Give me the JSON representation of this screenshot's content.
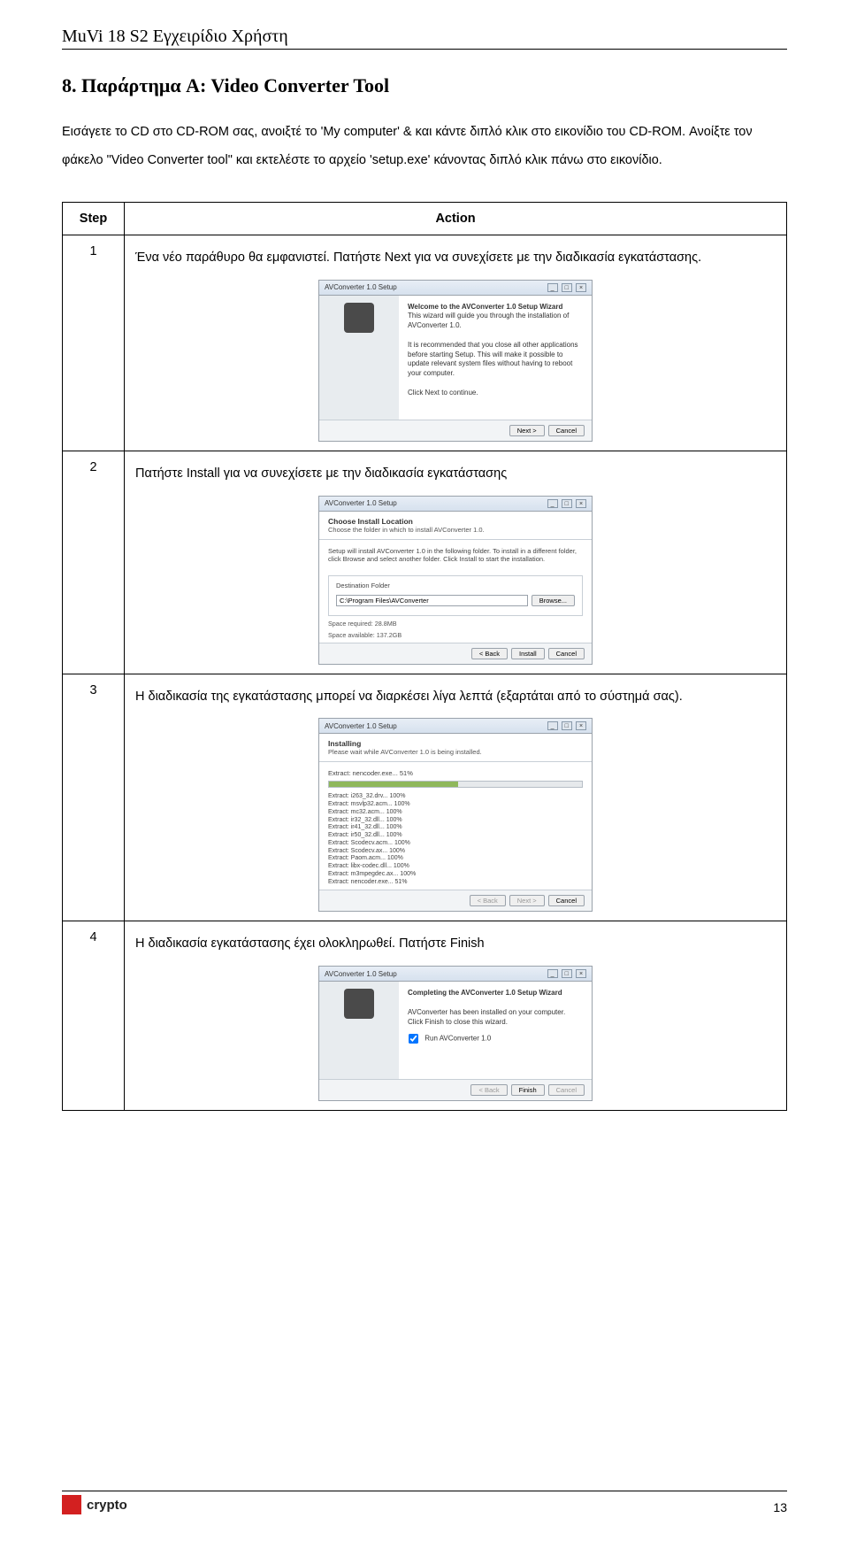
{
  "doc": {
    "header": "MuVi 18 S2 Εγχειρίδιο Χρήστη",
    "section_title": "8.    Παράρτημα A: Video Converter Tool",
    "intro": "Εισάγετε το CD στο CD-ROM σας, ανοιξτέ το 'My computer' & και κάντε διπλό κλικ στο εικονίδιο του CD-ROM. Ανοίξτε τον φάκελο \"Video Converter tool\" και εκτελέστε το αρχείο 'setup.exe' κάνοντας διπλό κλικ πάνω στο εικονίδιο.",
    "logo_text": "crypto",
    "page_number": "13"
  },
  "table": {
    "head_step": "Step",
    "head_action": "Action",
    "rows": [
      {
        "num": "1",
        "text": "Ένα νέο παράθυρο θα εμφανιστεί. Πατήστε Next για να συνεχίσετε με την διαδικασία εγκατάστασης."
      },
      {
        "num": "2",
        "text": "Πατήστε Install για να συνεχίσετε με την διαδικασία εγκατάστασης"
      },
      {
        "num": "3",
        "text": "Η διαδικασία της εγκατάστασης μπορεί να διαρκέσει λίγα λεπτά (εξαρτάται από το σύστημά σας)."
      },
      {
        "num": "4",
        "text": "Η διαδικασία εγκατάστασης έχει ολοκληρωθεί. Πατήστε Finish"
      }
    ]
  },
  "installer": {
    "title": "AVConverter 1.0 Setup",
    "step1": {
      "heading": "Welcome to the AVConverter 1.0 Setup Wizard",
      "p1": "This wizard will guide you through the installation of AVConverter 1.0.",
      "p2": "It is recommended that you close all other applications before starting Setup. This will make it possible to update relevant system files without having to reboot your computer.",
      "p3": "Click Next to continue.",
      "btn_next": "Next >",
      "btn_cancel": "Cancel"
    },
    "step2": {
      "h1": "Choose Install Location",
      "h2": "Choose the folder in which to install AVConverter 1.0.",
      "p1": "Setup will install AVConverter 1.0 in the following folder. To install in a different folder, click Browse and select another folder. Click Install to start the installation.",
      "dest_label": "Destination Folder",
      "dest_path": "C:\\Program Files\\AVConverter",
      "btn_browse": "Browse...",
      "space_req": "Space required: 28.8MB",
      "space_avail": "Space available: 137.2GB",
      "btn_back": "< Back",
      "btn_install": "Install",
      "btn_cancel": "Cancel"
    },
    "step3": {
      "h1": "Installing",
      "h2": "Please wait while AVConverter 1.0 is being installed.",
      "extract_line": "Extract: nencoder.exe... 51%",
      "files": [
        "Extract: i263_32.drv... 100%",
        "Extract: msvlp32.acm... 100%",
        "Extract: mc32.acm... 100%",
        "Extract: ir32_32.dll... 100%",
        "Extract: ir41_32.dll... 100%",
        "Extract: ir50_32.dll... 100%",
        "Extract: Scodecv.acm... 100%",
        "Extract: Scodecv.ax... 100%",
        "Extract: Paom.acm... 100%",
        "Extract: libx-codec.dll... 100%",
        "Extract: m3mpegdec.ax... 100%",
        "Extract: nencoder.exe... 51%"
      ],
      "btn_back": "< Back",
      "btn_next": "Next >",
      "btn_cancel": "Cancel"
    },
    "step4": {
      "heading": "Completing the AVConverter 1.0 Setup Wizard",
      "p1": "AVConverter has been installed on your computer.",
      "p2": "Click Finish to close this wizard.",
      "checkbox": "Run AVConverter 1.0",
      "btn_back": "< Back",
      "btn_finish": "Finish",
      "btn_cancel": "Cancel"
    }
  }
}
